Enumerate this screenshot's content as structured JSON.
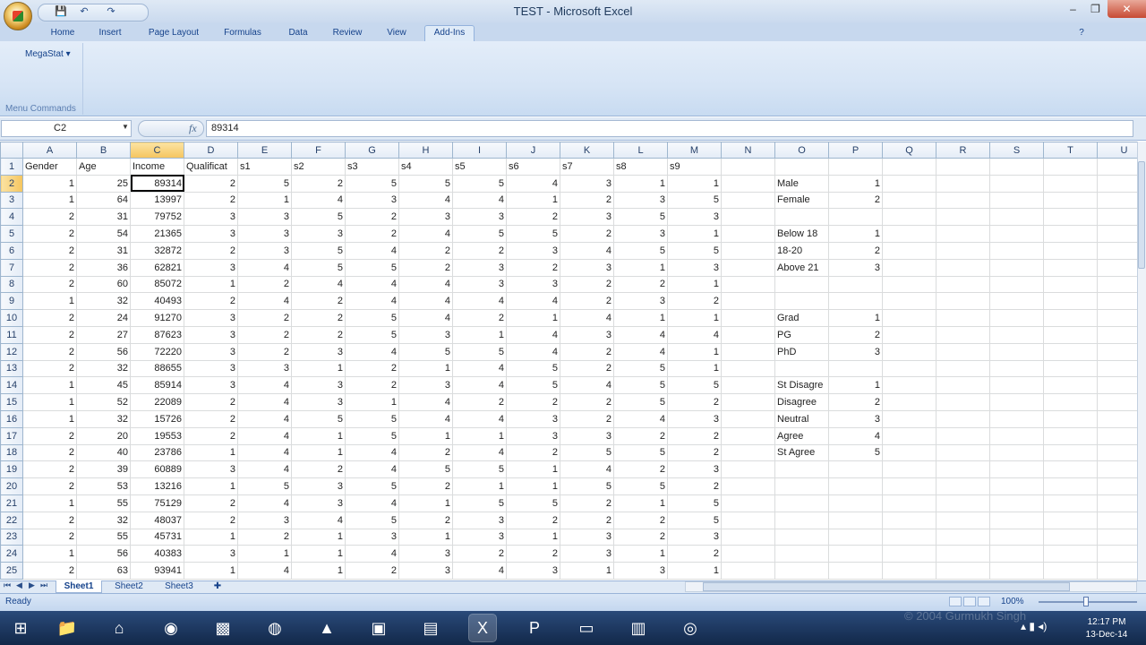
{
  "window": {
    "title": "TEST - Microsoft Excel",
    "minimize": "‒",
    "restore": "❐",
    "close": "✕"
  },
  "quick_access": {
    "save": "💾",
    "undo": "↶",
    "redo": "↷"
  },
  "ribbon": {
    "tabs": [
      "Home",
      "Insert",
      "Page Layout",
      "Formulas",
      "Data",
      "Review",
      "View",
      "Add-Ins"
    ],
    "active_tab": "Add-Ins",
    "megastat_label": "MegaStat ▾",
    "group_label": "Menu Commands"
  },
  "formula_bar": {
    "name_box": "C2",
    "fx": "fx",
    "value": "89314"
  },
  "columns": [
    "A",
    "B",
    "C",
    "D",
    "E",
    "F",
    "G",
    "H",
    "I",
    "J",
    "K",
    "L",
    "M",
    "N",
    "O",
    "P",
    "Q",
    "R",
    "S",
    "T",
    "U"
  ],
  "selected_column": "C",
  "selected_row": 2,
  "active_cell": "C2",
  "rows": [
    [
      "Gender",
      "Age",
      "Income",
      "Qualificat",
      "s1",
      "s2",
      "s3",
      "s4",
      "s5",
      "s6",
      "s7",
      "s8",
      "s9",
      "",
      "",
      "",
      "",
      "",
      "",
      "",
      ""
    ],
    [
      "1",
      "25",
      "89314",
      "2",
      "5",
      "2",
      "5",
      "5",
      "5",
      "4",
      "3",
      "1",
      "1",
      "",
      "Male",
      "1",
      "",
      "",
      "",
      "",
      ""
    ],
    [
      "1",
      "64",
      "13997",
      "2",
      "1",
      "4",
      "3",
      "4",
      "4",
      "1",
      "2",
      "3",
      "5",
      "",
      "Female",
      "2",
      "",
      "",
      "",
      "",
      ""
    ],
    [
      "2",
      "31",
      "79752",
      "3",
      "3",
      "5",
      "2",
      "3",
      "3",
      "2",
      "3",
      "5",
      "3",
      "",
      "",
      "",
      "",
      "",
      "",
      "",
      ""
    ],
    [
      "2",
      "54",
      "21365",
      "3",
      "3",
      "3",
      "2",
      "4",
      "5",
      "5",
      "2",
      "3",
      "1",
      "",
      "Below 18",
      "1",
      "",
      "",
      "",
      "",
      ""
    ],
    [
      "2",
      "31",
      "32872",
      "2",
      "3",
      "5",
      "4",
      "2",
      "2",
      "3",
      "4",
      "5",
      "5",
      "",
      "18-20",
      "2",
      "",
      "",
      "",
      "",
      ""
    ],
    [
      "2",
      "36",
      "62821",
      "3",
      "4",
      "5",
      "5",
      "2",
      "3",
      "2",
      "3",
      "1",
      "3",
      "",
      "Above 21",
      "3",
      "",
      "",
      "",
      "",
      ""
    ],
    [
      "2",
      "60",
      "85072",
      "1",
      "2",
      "4",
      "4",
      "4",
      "3",
      "3",
      "2",
      "2",
      "1",
      "",
      "",
      "",
      "",
      "",
      "",
      "",
      ""
    ],
    [
      "1",
      "32",
      "40493",
      "2",
      "4",
      "2",
      "4",
      "4",
      "4",
      "4",
      "2",
      "3",
      "2",
      "",
      "",
      "",
      "",
      "",
      "",
      "",
      ""
    ],
    [
      "2",
      "24",
      "91270",
      "3",
      "2",
      "2",
      "5",
      "4",
      "2",
      "1",
      "4",
      "1",
      "1",
      "",
      "Grad",
      "1",
      "",
      "",
      "",
      "",
      ""
    ],
    [
      "2",
      "27",
      "87623",
      "3",
      "2",
      "2",
      "5",
      "3",
      "1",
      "4",
      "3",
      "4",
      "4",
      "",
      "PG",
      "2",
      "",
      "",
      "",
      "",
      ""
    ],
    [
      "2",
      "56",
      "72220",
      "3",
      "2",
      "3",
      "4",
      "5",
      "5",
      "4",
      "2",
      "4",
      "1",
      "",
      "PhD",
      "3",
      "",
      "",
      "",
      "",
      ""
    ],
    [
      "2",
      "32",
      "88655",
      "3",
      "3",
      "1",
      "2",
      "1",
      "4",
      "5",
      "2",
      "5",
      "1",
      "",
      "",
      "",
      "",
      "",
      "",
      "",
      ""
    ],
    [
      "1",
      "45",
      "85914",
      "3",
      "4",
      "3",
      "2",
      "3",
      "4",
      "5",
      "4",
      "5",
      "5",
      "",
      "St Disagre",
      "1",
      "",
      "",
      "",
      "",
      ""
    ],
    [
      "1",
      "52",
      "22089",
      "2",
      "4",
      "3",
      "1",
      "4",
      "2",
      "2",
      "2",
      "5",
      "2",
      "",
      "Disagree",
      "2",
      "",
      "",
      "",
      "",
      ""
    ],
    [
      "1",
      "32",
      "15726",
      "2",
      "4",
      "5",
      "5",
      "4",
      "4",
      "3",
      "2",
      "4",
      "3",
      "",
      "Neutral",
      "3",
      "",
      "",
      "",
      "",
      ""
    ],
    [
      "2",
      "20",
      "19553",
      "2",
      "4",
      "1",
      "5",
      "1",
      "1",
      "3",
      "3",
      "2",
      "2",
      "",
      "Agree",
      "4",
      "",
      "",
      "",
      "",
      ""
    ],
    [
      "2",
      "40",
      "23786",
      "1",
      "4",
      "1",
      "4",
      "2",
      "4",
      "2",
      "5",
      "5",
      "2",
      "",
      "St Agree",
      "5",
      "",
      "",
      "",
      "",
      ""
    ],
    [
      "2",
      "39",
      "60889",
      "3",
      "4",
      "2",
      "4",
      "5",
      "5",
      "1",
      "4",
      "2",
      "3",
      "",
      "",
      "",
      "",
      "",
      "",
      "",
      ""
    ],
    [
      "2",
      "53",
      "13216",
      "1",
      "5",
      "3",
      "5",
      "2",
      "1",
      "1",
      "5",
      "5",
      "2",
      "",
      "",
      "",
      "",
      "",
      "",
      "",
      ""
    ],
    [
      "1",
      "55",
      "75129",
      "2",
      "4",
      "3",
      "4",
      "1",
      "5",
      "5",
      "2",
      "1",
      "5",
      "",
      "",
      "",
      "",
      "",
      "",
      "",
      ""
    ],
    [
      "2",
      "32",
      "48037",
      "2",
      "3",
      "4",
      "5",
      "2",
      "3",
      "2",
      "2",
      "2",
      "5",
      "",
      "",
      "",
      "",
      "",
      "",
      "",
      ""
    ],
    [
      "2",
      "55",
      "45731",
      "1",
      "2",
      "1",
      "3",
      "1",
      "3",
      "1",
      "3",
      "2",
      "3",
      "",
      "",
      "",
      "",
      "",
      "",
      "",
      ""
    ],
    [
      "1",
      "56",
      "40383",
      "3",
      "1",
      "1",
      "4",
      "3",
      "2",
      "2",
      "3",
      "1",
      "2",
      "",
      "",
      "",
      "",
      "",
      "",
      "",
      ""
    ],
    [
      "2",
      "63",
      "93941",
      "1",
      "4",
      "1",
      "2",
      "3",
      "4",
      "3",
      "1",
      "3",
      "1",
      "",
      "",
      "",
      "",
      "",
      "",
      "",
      ""
    ]
  ],
  "sheet_tabs": [
    "Sheet1",
    "Sheet2",
    "Sheet3"
  ],
  "active_sheet": "Sheet1",
  "status": {
    "text": "Ready",
    "zoom": "100%"
  },
  "taskbar": {
    "apps": [
      "start-icon",
      "explorer-icon",
      "home-icon",
      "media-icon",
      "paint-icon",
      "firefox-icon",
      "vlc-icon",
      "virtualbox-icon",
      "word-icon",
      "excel-icon",
      "powerpoint-icon",
      "window-icon",
      "notepad-icon",
      "chrome-icon"
    ],
    "time": "12:17 PM",
    "date": "13-Dec-14",
    "watermark": "© 2004 Gurmukh Singh"
  }
}
